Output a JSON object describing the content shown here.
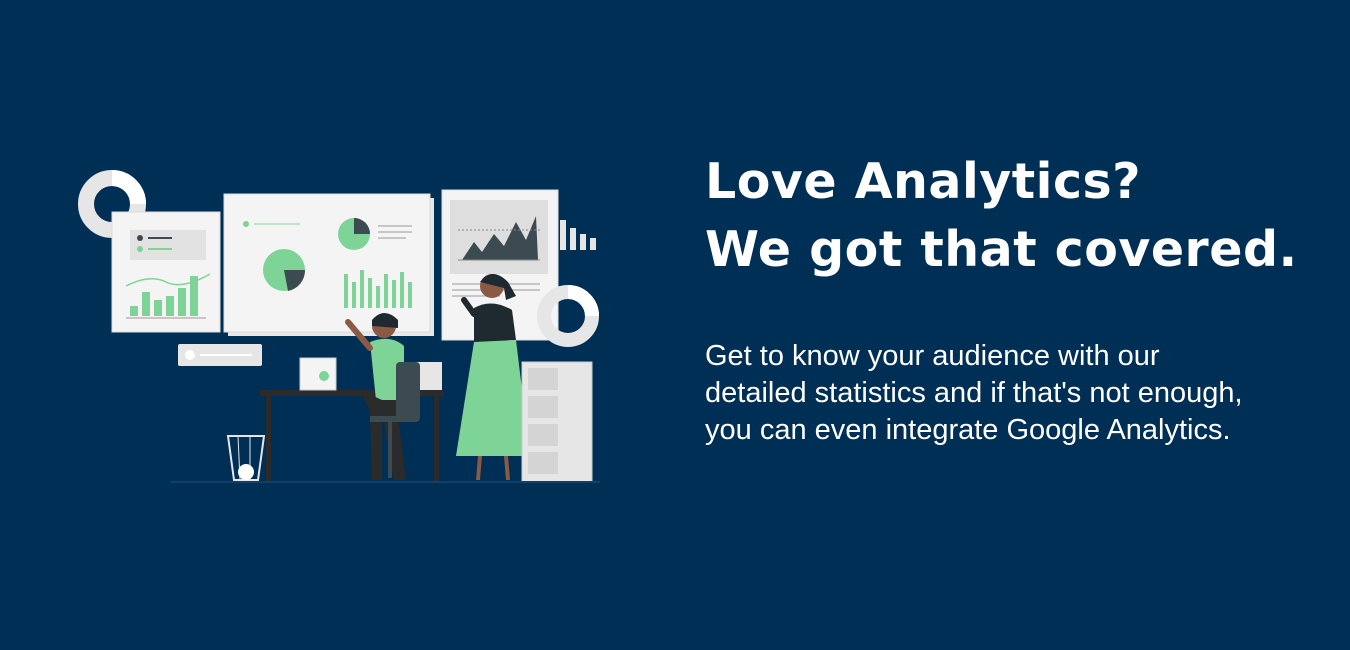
{
  "headline": {
    "line1": "Love Analytics?",
    "line2": "We got that covered."
  },
  "description": "Get to know your audience with our detailed statistics and if that's not enough, you can even integrate Google Analytics.",
  "colors": {
    "background": "#002f56",
    "accent_green": "#7ed497",
    "text": "#ffffff",
    "panel": "#f4f4f4",
    "dark_chart": "#3c4a52"
  },
  "illustration": {
    "icon": "analytics-team-illustration"
  }
}
